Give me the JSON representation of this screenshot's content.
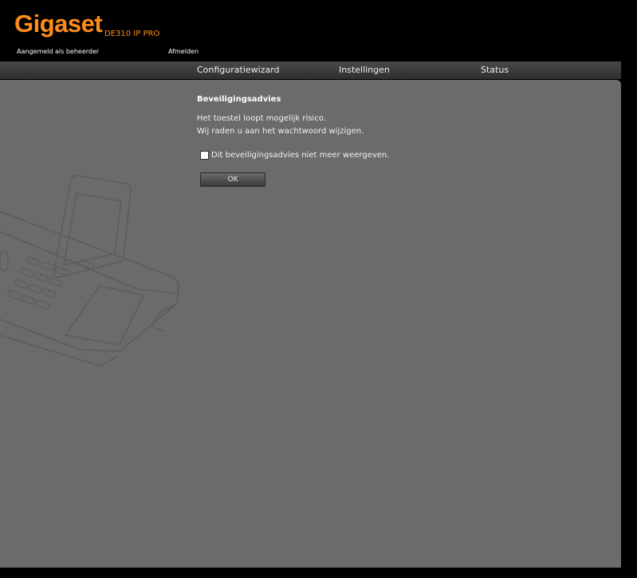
{
  "header": {
    "brand": "Gigaset",
    "model": "DE310 IP PRO",
    "login_status": "Aangemeld als beheerder",
    "logout_label": "Afmelden"
  },
  "nav": {
    "tabs": [
      {
        "label": "Configuratiewizard"
      },
      {
        "label": "Instellingen"
      },
      {
        "label": "Status"
      }
    ]
  },
  "advice": {
    "title": "Beveiligingsadvies",
    "lines": [
      "Het toestel loopt mogelijk risico.",
      "Wij raden u aan het wachtwoord wijzigen."
    ],
    "checkbox_label": "Dit beveiligingsadvies niet meer weergeven.",
    "ok_label": "OK"
  },
  "colors": {
    "brand": "#ff8c1a",
    "panel": "#6b6b6b",
    "background": "#000000"
  }
}
